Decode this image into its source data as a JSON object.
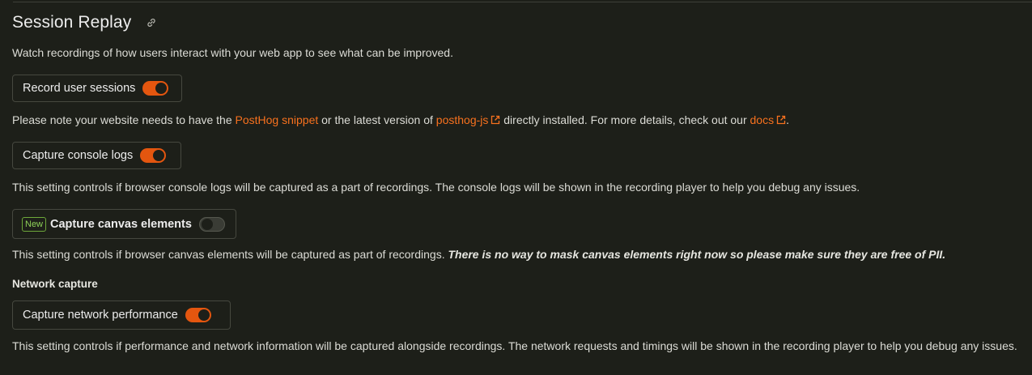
{
  "page": {
    "title": "Session Replay",
    "intro": "Watch recordings of how users interact with your web app to see what can be improved."
  },
  "record_sessions": {
    "label": "Record user sessions",
    "enabled": true,
    "note_prefix": "Please note your website needs to have the ",
    "snippet_link": "PostHog snippet",
    "note_mid": " or the latest version of ",
    "posthogjs_link": "posthog-js",
    "note_mid2": " directly installed. For more details, check out our ",
    "docs_link": "docs",
    "note_suffix": "."
  },
  "console_logs": {
    "label": "Capture console logs",
    "enabled": true,
    "description": "This setting controls if browser console logs will be captured as a part of recordings. The console logs will be shown in the recording player to help you debug any issues."
  },
  "canvas": {
    "badge": "New",
    "label": "Capture canvas elements",
    "enabled": false,
    "description": "This setting controls if browser canvas elements will be captured as part of recordings. ",
    "warning": "There is no way to mask canvas elements right now so please make sure they are free of PII."
  },
  "network": {
    "heading": "Network capture",
    "label": "Capture network performance",
    "enabled": true,
    "description": "This setting controls if performance and network information will be captured alongside recordings. The network requests and timings will be shown in the recording player to help you debug any issues."
  },
  "colors": {
    "accent": "#e4560f",
    "link": "#f7711e",
    "badge_green": "#8ed158",
    "background": "#1d1f19"
  },
  "icons": [
    "link-icon",
    "external-link-icon"
  ]
}
